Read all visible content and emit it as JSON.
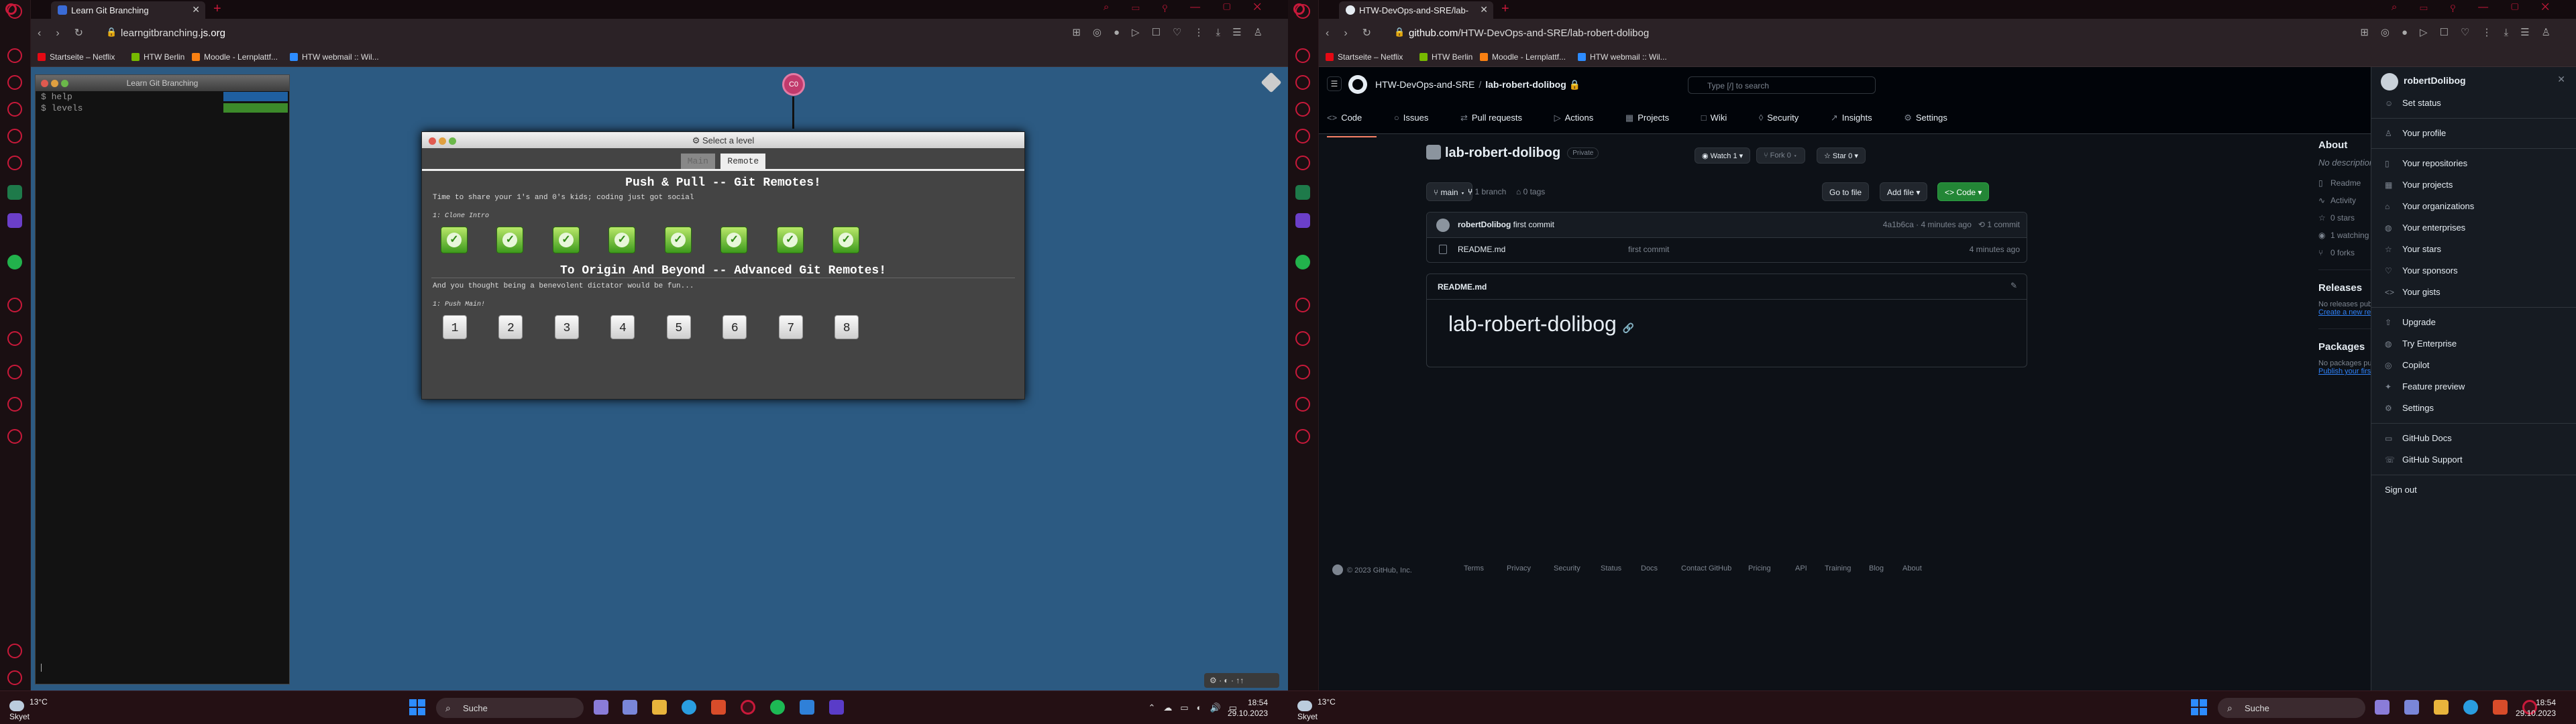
{
  "left": {
    "tab_title": "Learn Git Branching",
    "url_host": "learngitbranching",
    "url_domain": ".js.org",
    "bookmarks": [
      "Startseite – Netflix",
      "HTW Berlin",
      "Moodle - Lernplattf...",
      "HTW webmail :: Wil..."
    ],
    "terminal": {
      "title": "Learn Git Branching",
      "lines": [
        "$ help",
        "$ levels"
      ]
    },
    "git_node": "C0",
    "dialog": {
      "title": "Select a level",
      "tab_main": "Main",
      "tab_remote": "Remote",
      "section1_title": "Push & Pull -- Git Remotes!",
      "section1_desc": "Time to share your 1's and 0's kids; coding just got social",
      "section1_sub": "1: Clone Intro",
      "section2_title": "To Origin And Beyond -- Advanced Git Remotes!",
      "section2_desc": "And you thought being a benevolent dictator would be fun...",
      "section2_sub": "1: Push Main!",
      "levels2": [
        "1",
        "2",
        "3",
        "4",
        "5",
        "6",
        "7",
        "8"
      ],
      "completed_count": 8
    },
    "corner_widget": "⚙ · ◐ · ↑↑",
    "taskbar": {
      "temp": "13°C",
      "cond": "Skyet",
      "search": "Suche",
      "time": "18:54",
      "date": "29.10.2023"
    }
  },
  "right": {
    "tab_title": "HTW-DevOps-and-SRE/lab-",
    "url_host": "github.com",
    "url_path": "/HTW-DevOps-and-SRE/lab-robert-dolibog",
    "bookmarks": [
      "Startseite – Netflix",
      "HTW Berlin",
      "Moodle - Lernplattf...",
      "HTW webmail :: Wil..."
    ],
    "gh": {
      "org": "HTW-DevOps-and-SRE",
      "repo": "lab-robert-dolibog",
      "search_placeholder": "Type [/] to search",
      "nav": [
        {
          "icon": "<>",
          "label": "Code"
        },
        {
          "icon": "○",
          "label": "Issues"
        },
        {
          "icon": "⇄",
          "label": "Pull requests"
        },
        {
          "icon": "▷",
          "label": "Actions"
        },
        {
          "icon": "▦",
          "label": "Projects"
        },
        {
          "icon": "□",
          "label": "Wiki"
        },
        {
          "icon": "◊",
          "label": "Security"
        },
        {
          "icon": "↗",
          "label": "Insights"
        },
        {
          "icon": "⚙",
          "label": "Settings"
        }
      ],
      "visibility": "Private",
      "watch": "Watch",
      "watch_count": "1",
      "fork": "Fork",
      "fork_count": "0",
      "star": "Star",
      "star_count": "0",
      "branch": "main",
      "branches": "1 branch",
      "tags": "0 tags",
      "go_to_file": "Go to file",
      "add_file": "Add file",
      "code_btn": "Code",
      "commit_author": "robertDolibog",
      "commit_msg": "first commit",
      "commit_hash": "4a1b6ca",
      "commit_time": "4 minutes ago",
      "commit_count": "1 commit",
      "file_name": "README.md",
      "file_msg": "first commit",
      "file_time": "4 minutes ago",
      "readme_label": "README.md",
      "readme_h1": "lab-robert-dolibog",
      "about": {
        "title": "About",
        "desc": "No description, website, or topics provided.",
        "items": [
          "Readme",
          "Activity",
          "0 stars",
          "1 watching",
          "0 forks"
        ]
      },
      "releases": {
        "title": "Releases",
        "text": "No releases published",
        "link": "Create a new release"
      },
      "packages": {
        "title": "Packages",
        "text": "No packages published",
        "link": "Publish your first package"
      },
      "footer": [
        "© 2023 GitHub, Inc.",
        "Terms",
        "Privacy",
        "Security",
        "Status",
        "Docs",
        "Contact GitHub",
        "Pricing",
        "API",
        "Training",
        "Blog",
        "About"
      ],
      "user_panel": {
        "username": "robertDolibog",
        "items": [
          [
            "Set status"
          ],
          [
            "Your profile"
          ],
          [
            "Your repositories",
            "Your projects",
            "Your organizations",
            "Your enterprises",
            "Your stars",
            "Your sponsors",
            "Your gists"
          ],
          [
            "Upgrade",
            "Try Enterprise",
            "Copilot",
            "Feature preview",
            "Settings"
          ],
          [
            "GitHub Docs",
            "GitHub Support"
          ],
          [
            "Sign out"
          ]
        ]
      }
    },
    "taskbar": {
      "temp": "13°C",
      "cond": "Skyet",
      "search": "Suche",
      "time": "18:54",
      "date": "29.10.2023"
    }
  },
  "colors": {
    "opera": "#c8193a",
    "lgb_bg": "#2c5a82",
    "gh_bg": "#0d1117",
    "gh_green": "#238636"
  }
}
